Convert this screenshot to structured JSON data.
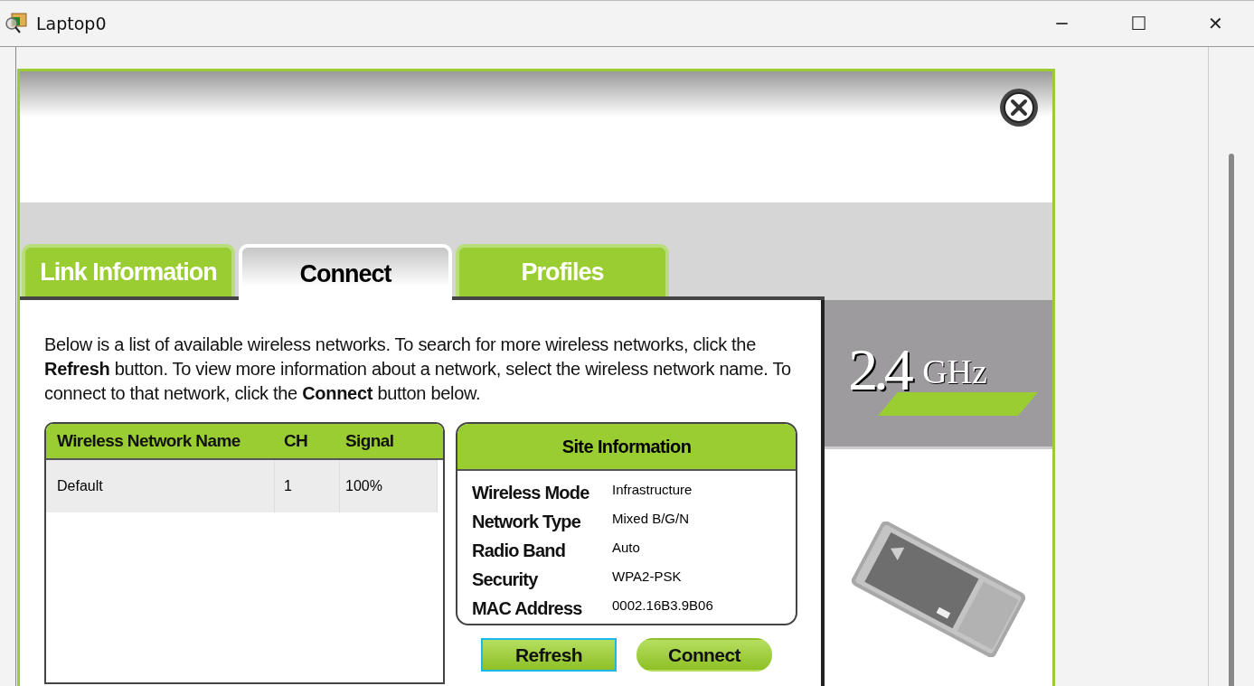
{
  "window": {
    "title": "Laptop0",
    "controls": [
      "─",
      "☐",
      "✕"
    ]
  },
  "tabs": [
    {
      "label": "Link Information",
      "selected": false
    },
    {
      "label": "Connect",
      "selected": true
    },
    {
      "label": "Profiles",
      "selected": false
    }
  ],
  "description": "Below is a list of available wireless networks. To search for more wireless networks, click the **Refresh** button. To view more information about a network, select the wireless network name. To connect to that network, click the **Connect** button below.",
  "networks": {
    "columns": [
      "Wireless Network Name",
      "CH",
      "Signal"
    ],
    "rows": [
      {
        "cells": [
          "Default",
          "1",
          "100%"
        ],
        "selected": true
      }
    ]
  },
  "site_information": {
    "title": "Site Information",
    "fields": [
      {
        "label": "Wireless Mode",
        "value": "Infrastructure"
      },
      {
        "label": "Network Type",
        "value": "Mixed B/G/N"
      },
      {
        "label": "Radio Band",
        "value": "Auto"
      },
      {
        "label": "Security",
        "value": "WPA2-PSK"
      },
      {
        "label": "MAC Address",
        "value": "0002.16B3.9B06"
      }
    ]
  },
  "buttons": [
    {
      "label": "Refresh",
      "focused": true
    },
    {
      "label": "Connect",
      "focused": false
    }
  ],
  "band_logo": {
    "number": "2.4",
    "unit": "GHz"
  }
}
